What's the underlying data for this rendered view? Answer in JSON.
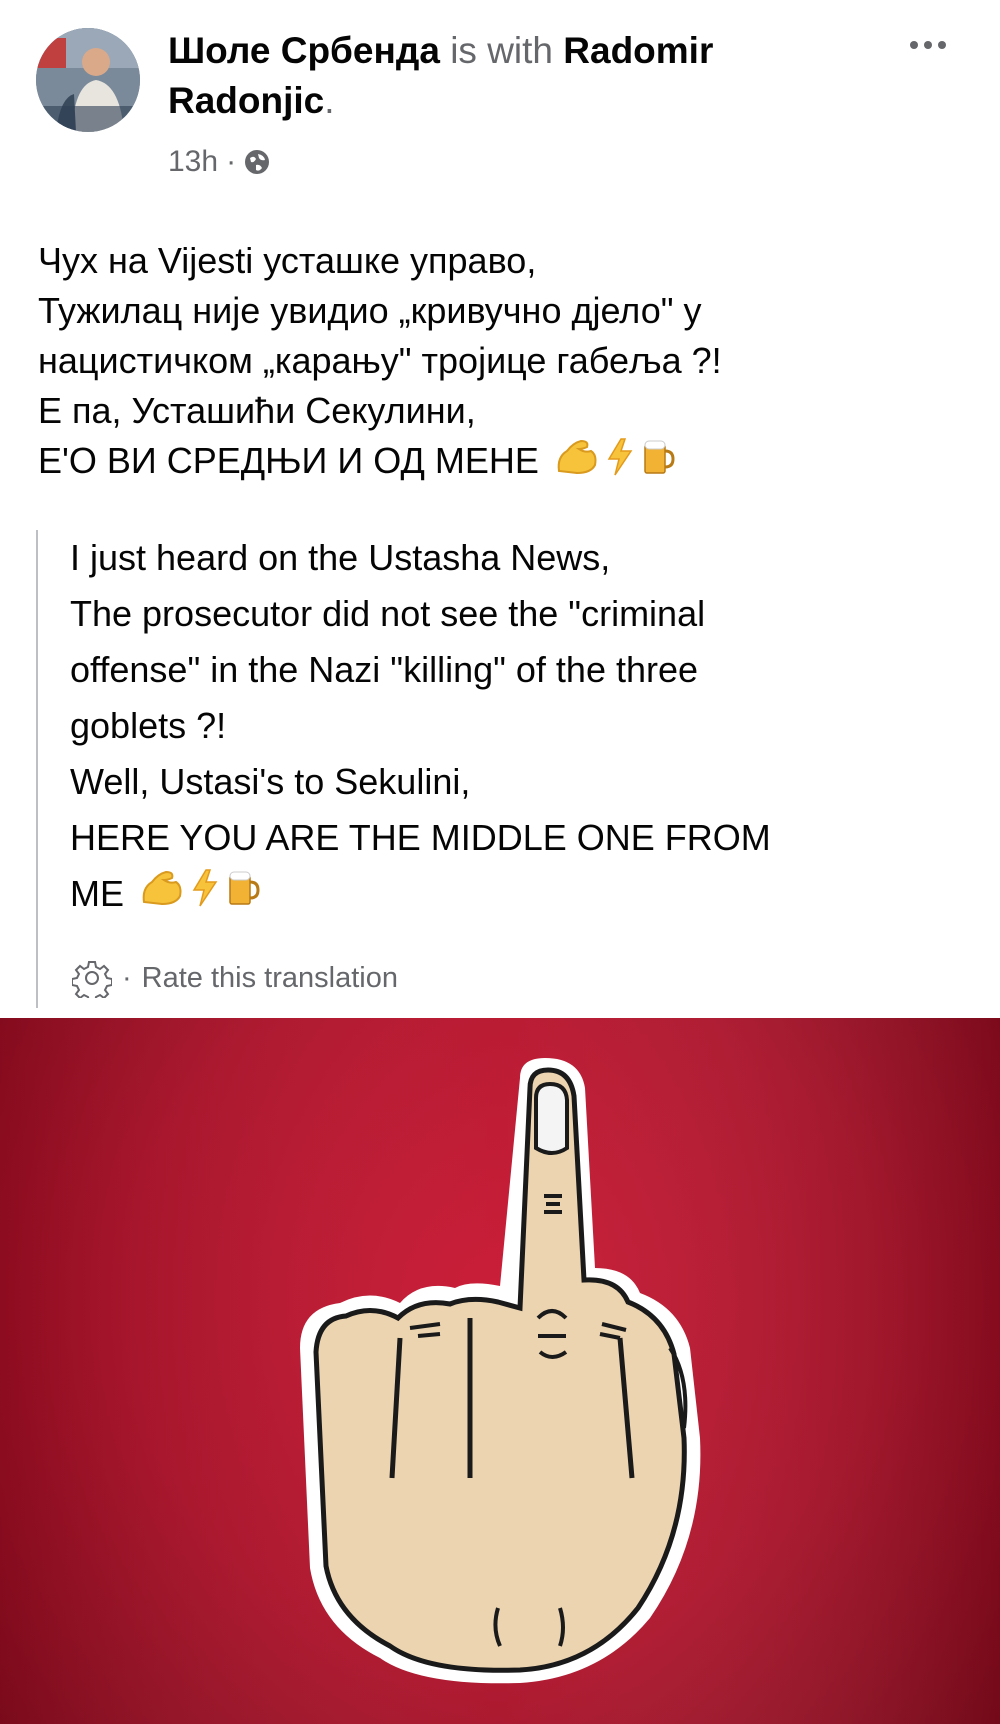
{
  "post": {
    "author": "Шоле Србенда",
    "with_text": "is with",
    "tagged": "Radomir Radonjic",
    "time": "13h",
    "privacy_icon": "globe-icon",
    "more_icon": "more-dots-icon"
  },
  "original_lines": [
    "Чух на Vijesti усташке управо,",
    "Тужилац није увидио „кривучно дјело\" у",
    "нацистичком „карању\" тројице габеља ?!",
    "Е па, Усташићи Секулини,",
    "Е'О ВИ СРЕДЊИ И ОД МЕНЕ"
  ],
  "translation_lines": [
    "I just heard on the Ustasha News,",
    "The prosecutor did not see the \"criminal",
    "offense\" in the Nazi \"killing\" of the three",
    "goblets ?!",
    "Well, Ustasi's to Sekulini,",
    "HERE YOU ARE THE MIDDLE ONE FROM",
    "ME"
  ],
  "emojis": [
    "flexed-biceps-icon",
    "lightning-icon",
    "beer-mug-icon"
  ],
  "rate_translation": "Rate this translation",
  "settings_icon": "gear-icon",
  "photo": {
    "subject": "middle-finger-hand-icon",
    "background_color": "#b30f28"
  },
  "colors": {
    "secondary_text": "#65676b",
    "divider": "#bcc0c4"
  }
}
